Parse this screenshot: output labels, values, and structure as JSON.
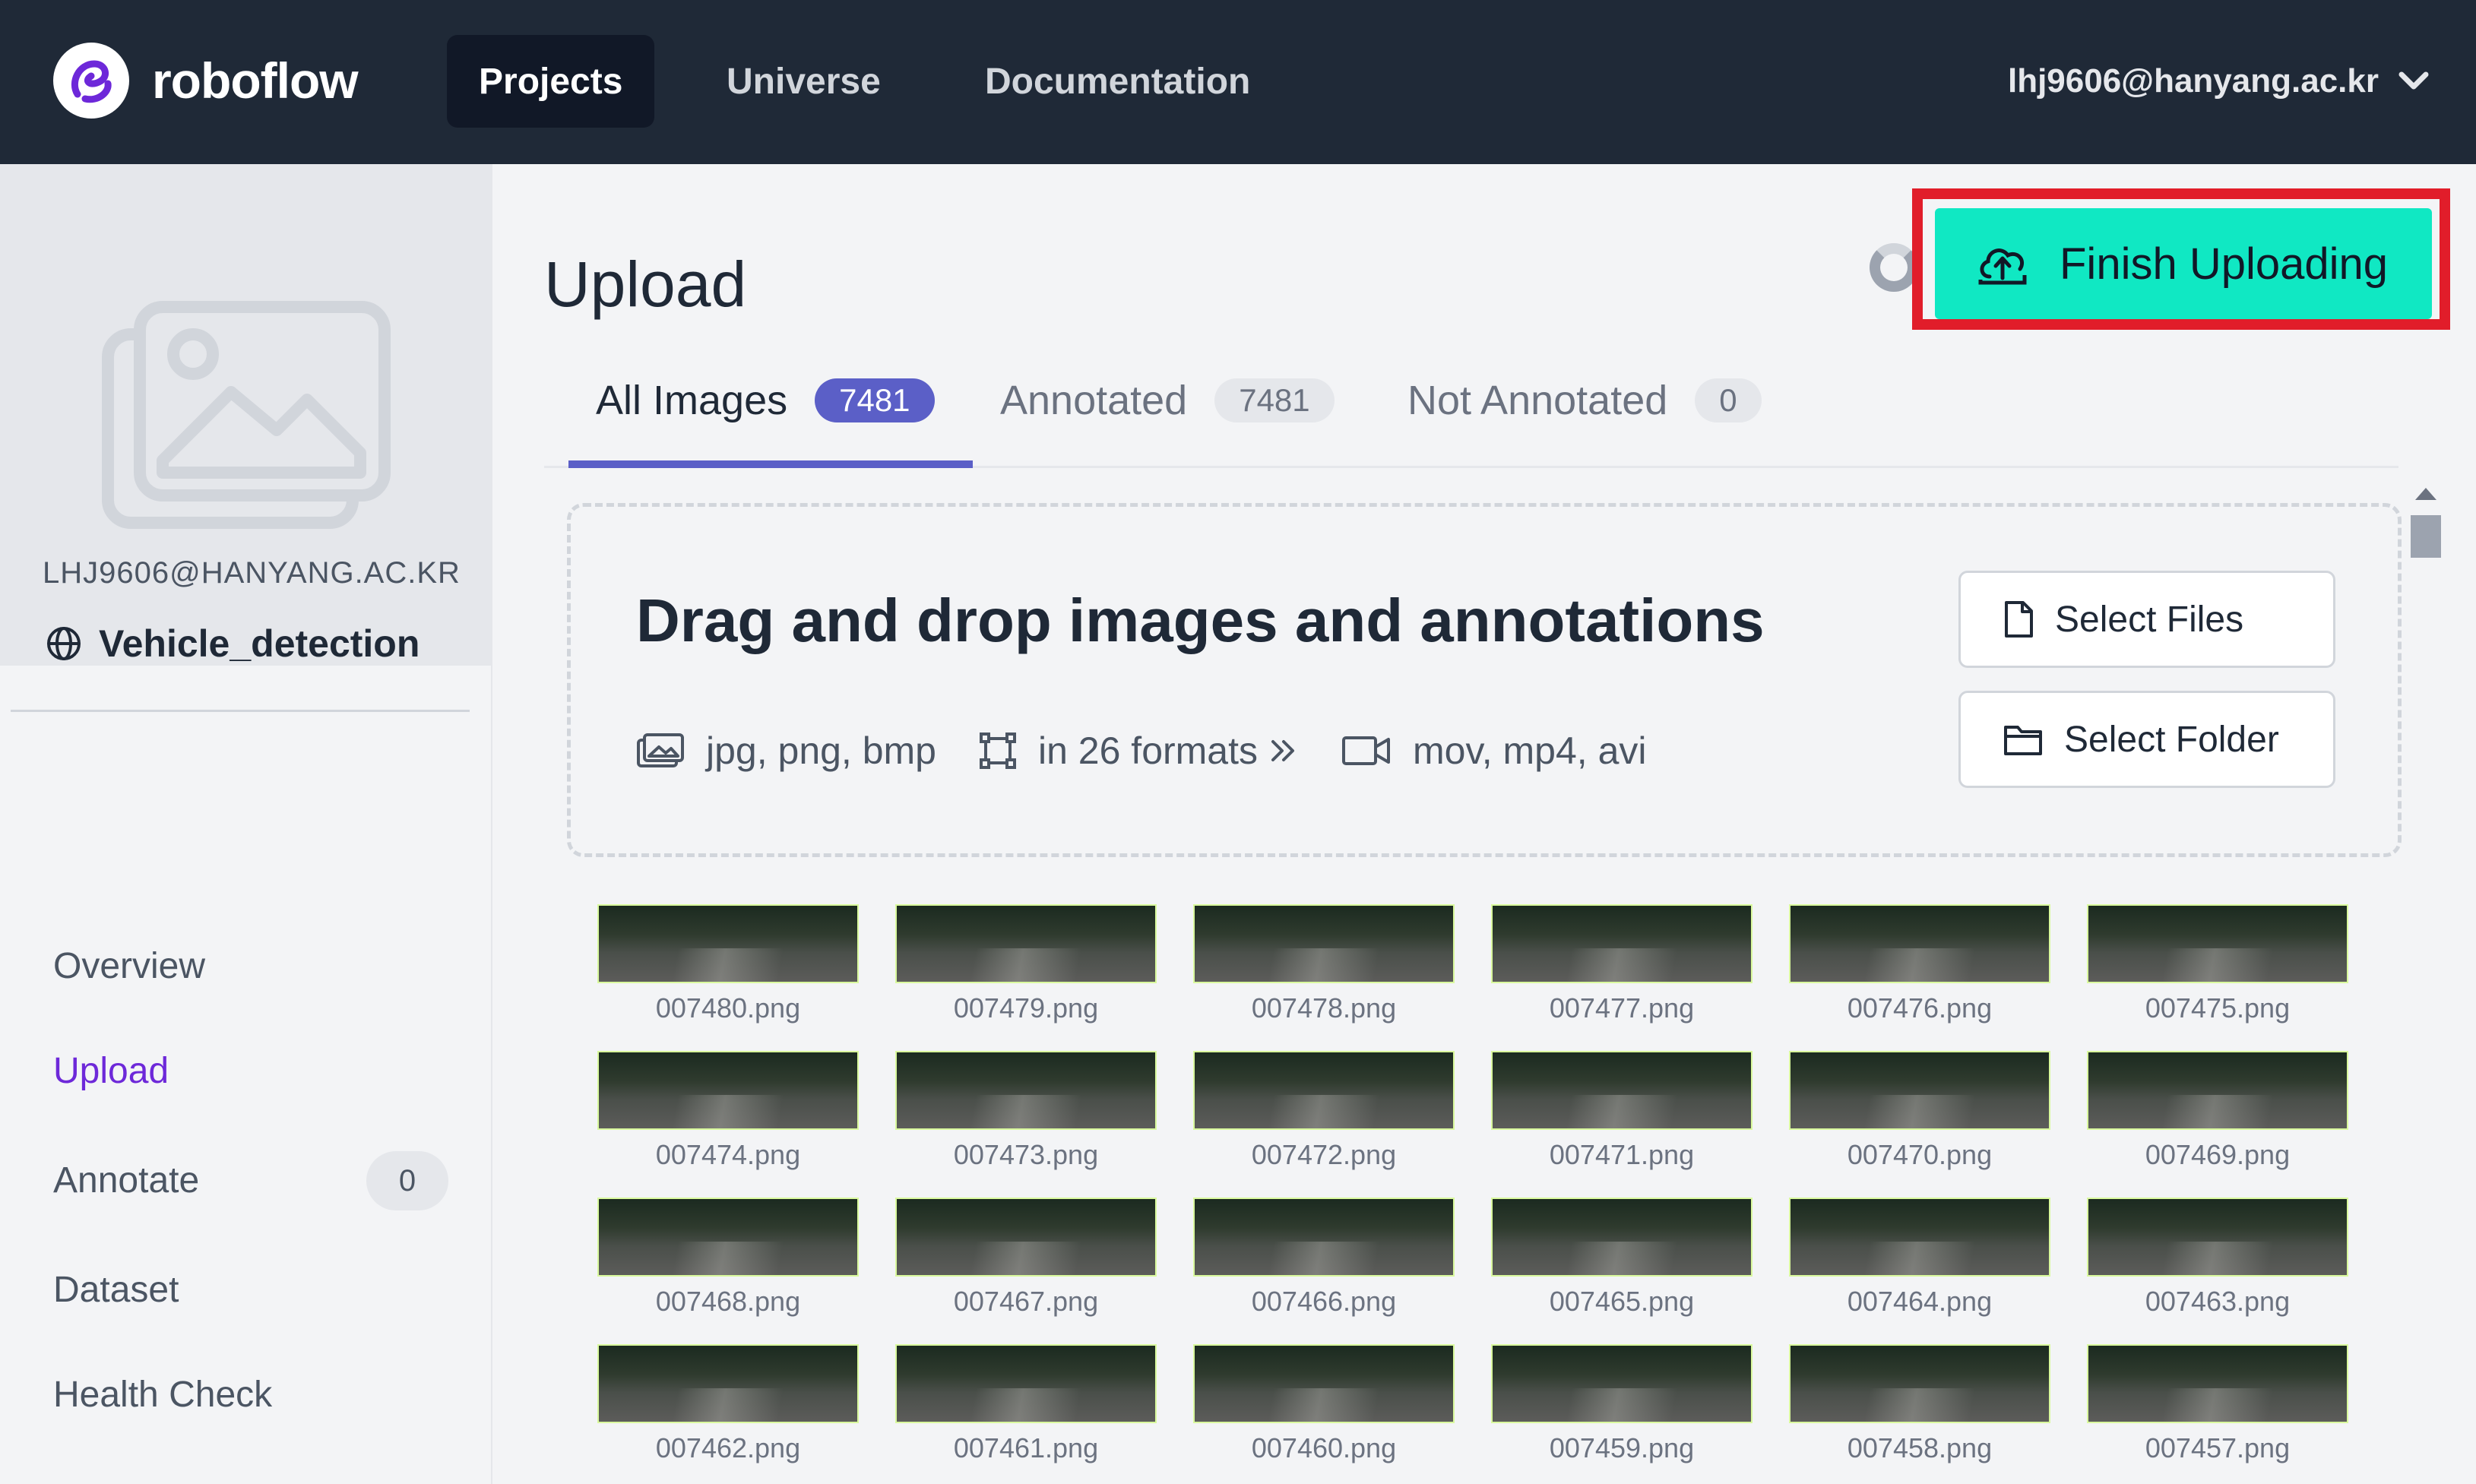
{
  "brand": {
    "name": "roboflow",
    "color": "#6d28d9"
  },
  "nav": {
    "items": [
      {
        "label": "Projects",
        "active": true
      },
      {
        "label": "Universe",
        "active": false
      },
      {
        "label": "Documentation",
        "active": false
      }
    ],
    "user_email": "lhj9606@hanyang.ac.kr"
  },
  "sidebar": {
    "workspace": "LHJ9606@HANYANG.AC.KR",
    "project_name": "Vehicle_detection",
    "items": [
      {
        "label": "Overview",
        "active": false
      },
      {
        "label": "Upload",
        "active": true
      },
      {
        "label": "Annotate",
        "active": false,
        "badge": "0"
      },
      {
        "label": "Dataset",
        "active": false
      },
      {
        "label": "Health Check",
        "active": false
      }
    ]
  },
  "page": {
    "title": "Upload",
    "finish_button": "Finish Uploading",
    "accent_color": "#10e8c3"
  },
  "tabs": [
    {
      "label": "All Images",
      "count": "7481",
      "active": true
    },
    {
      "label": "Annotated",
      "count": "7481",
      "active": false
    },
    {
      "label": "Not Annotated",
      "count": "0",
      "active": false
    }
  ],
  "dropzone": {
    "title": "Drag and drop images and annotations",
    "formats": [
      "jpg, png, bmp",
      "in 26 formats",
      "mov, mp4, avi"
    ],
    "select_files": "Select Files",
    "select_folder": "Select Folder"
  },
  "images": [
    "007480.png",
    "007479.png",
    "007478.png",
    "007477.png",
    "007476.png",
    "007475.png",
    "007474.png",
    "007473.png",
    "007472.png",
    "007471.png",
    "007470.png",
    "007469.png",
    "007468.png",
    "007467.png",
    "007466.png",
    "007465.png",
    "007464.png",
    "007463.png",
    "007462.png",
    "007461.png",
    "007460.png",
    "007459.png",
    "007458.png",
    "007457.png"
  ]
}
